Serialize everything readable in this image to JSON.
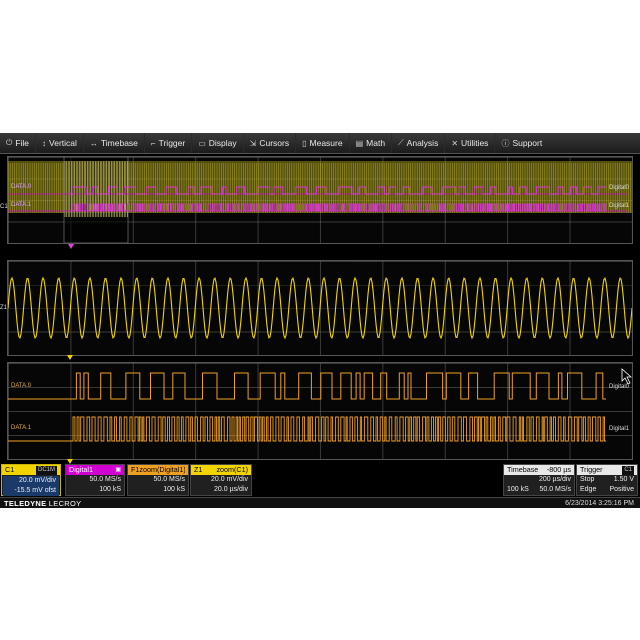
{
  "menu": [
    {
      "label": "File",
      "icon": "power-icon",
      "glyph": "⏻"
    },
    {
      "label": "Vertical",
      "icon": "vertical-arrows-icon",
      "glyph": "↕"
    },
    {
      "label": "Timebase",
      "icon": "horizontal-arrows-icon",
      "glyph": "↔"
    },
    {
      "label": "Trigger",
      "icon": "trigger-icon",
      "glyph": "⌐"
    },
    {
      "label": "Display",
      "icon": "display-icon",
      "glyph": "▭"
    },
    {
      "label": "Cursors",
      "icon": "cursor-icon",
      "glyph": "⇲"
    },
    {
      "label": "Measure",
      "icon": "measure-icon",
      "glyph": "▯"
    },
    {
      "label": "Math",
      "icon": "math-icon",
      "glyph": "▤"
    },
    {
      "label": "Analysis",
      "icon": "analysis-icon",
      "glyph": "⟋"
    },
    {
      "label": "Utilities",
      "icon": "tools-icon",
      "glyph": "✕"
    },
    {
      "label": "Support",
      "icon": "info-icon",
      "glyph": "ⓘ"
    }
  ],
  "grid1": {
    "channel_label": "C1",
    "trace0": "DATA.0",
    "trace1": "DATA.1",
    "tag0": "Digital0",
    "tag1": "Digital1"
  },
  "grid2": {
    "channel_label": "Z1"
  },
  "grid3": {
    "trace0": "DATA.0",
    "trace1": "DATA.1",
    "tag0": "Digital0",
    "tag1": "Digital1"
  },
  "descriptors": {
    "c1": {
      "name": "C1",
      "coupling": "DC1M",
      "line1": "20.0 mV/div",
      "line2": "-15.5 mV ofst"
    },
    "d1": {
      "name": "Digital1",
      "line1": "50.0 MS/s",
      "line2": "100 kS"
    },
    "fz": {
      "name": "F1zoom(Digital1)",
      "line1": "50.0 MS/s",
      "line2": "100 kS"
    },
    "z1": {
      "name": "Z1",
      "func": "zoom(C1)",
      "line1": "20.0 mV/div",
      "line2": "20.0 µs/div"
    }
  },
  "timebase": {
    "label": "Timebase",
    "delay": "-800 µs",
    "div": "200 µs/div",
    "samples": "100 kS",
    "rate": "50.0 MS/s"
  },
  "trigger": {
    "label": "Trigger",
    "channel": "C1",
    "mode": "Stop",
    "level": "1.50 V",
    "type": "Edge",
    "slope": "Positive"
  },
  "status": {
    "brand_bold": "TELEDYNE",
    "brand_light": " LECROY",
    "datetime": "6/23/2014 3:25:16 PM"
  },
  "colors": {
    "c1": "#f2d500",
    "digital": "#d000d0",
    "zoom": "#f0a020"
  }
}
